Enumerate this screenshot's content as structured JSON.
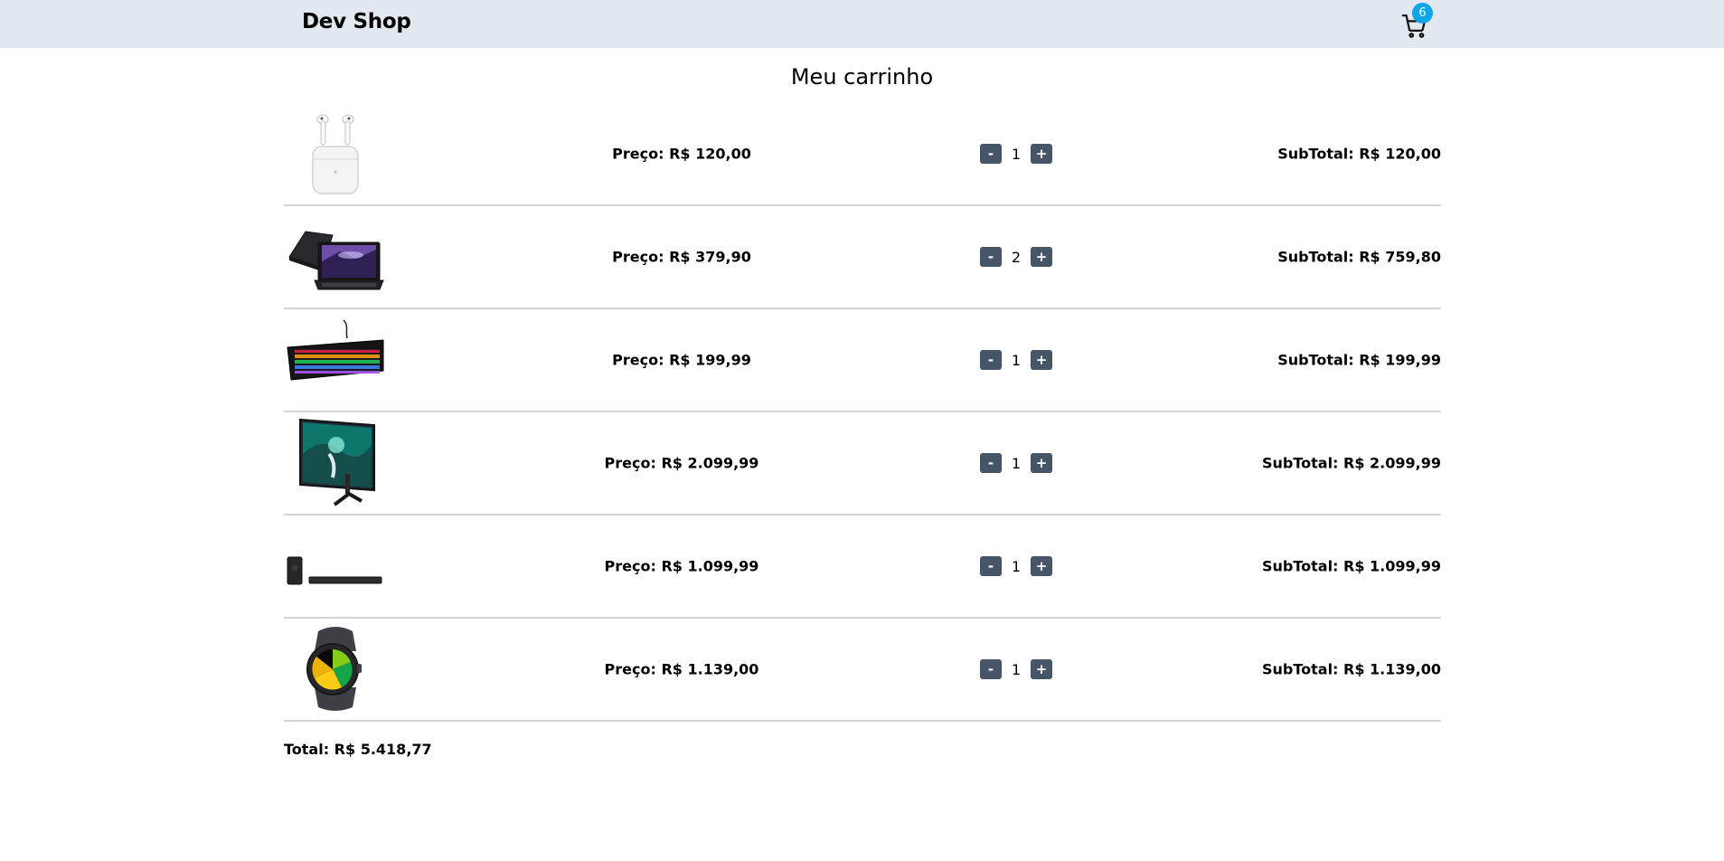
{
  "header": {
    "brand": "Dev Shop",
    "cart_count": "6",
    "cart_icon": "shopping-cart-icon",
    "background_color": "#e2e8f0",
    "badge_color": "#0ea5e9"
  },
  "page": {
    "title": "Meu carrinho"
  },
  "cart": {
    "items": [
      {
        "image": "airpods",
        "price": "Preço: R$ 120,00",
        "qty": "1",
        "subtotal": "SubTotal: R$ 120,00",
        "minus": "-",
        "plus": "+"
      },
      {
        "image": "laptop",
        "price": "Preço: R$ 379,90",
        "qty": "2",
        "subtotal": "SubTotal: R$ 759,80",
        "minus": "-",
        "plus": "+"
      },
      {
        "image": "keyboard",
        "price": "Preço: R$ 199,99",
        "qty": "1",
        "subtotal": "SubTotal: R$ 199,99",
        "minus": "-",
        "plus": "+"
      },
      {
        "image": "monitor",
        "price": "Preço: R$ 2.099,99",
        "qty": "1",
        "subtotal": "SubTotal: R$ 2.099,99",
        "minus": "-",
        "plus": "+"
      },
      {
        "image": "soundbar",
        "price": "Preço: R$ 1.099,99",
        "qty": "1",
        "subtotal": "SubTotal: R$ 1.099,99",
        "minus": "-",
        "plus": "+"
      },
      {
        "image": "smartwatch",
        "price": "Preço: R$ 1.139,00",
        "qty": "1",
        "subtotal": "SubTotal: R$ 1.139,00",
        "minus": "-",
        "plus": "+"
      }
    ],
    "total": "Total: R$ 5.418,77",
    "button_color": "#475569"
  }
}
